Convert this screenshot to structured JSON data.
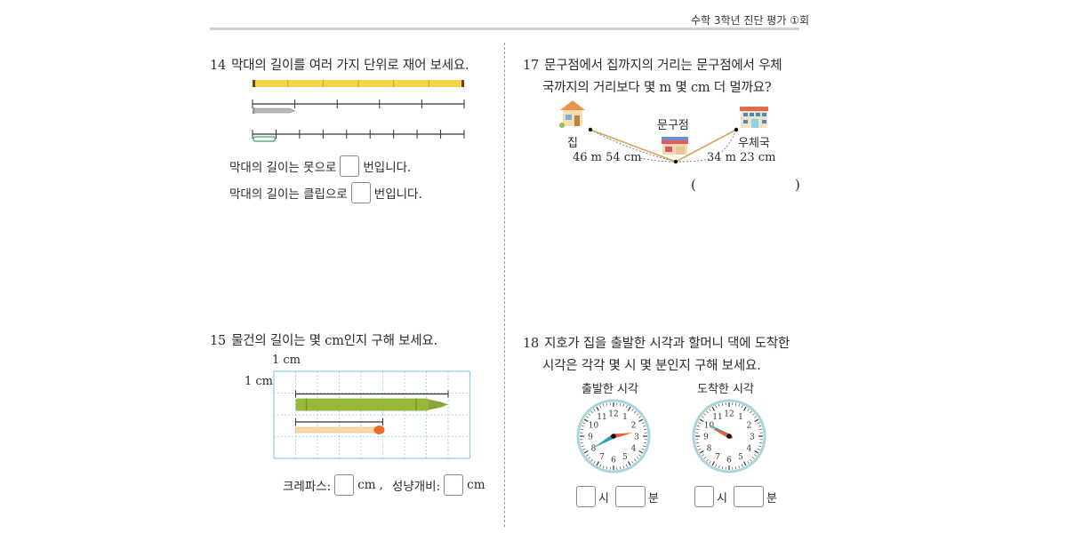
{
  "header": {
    "title": "수학 3학년 진단 평가 ①회"
  },
  "questions": {
    "q14": {
      "number": "14",
      "text": "막대의 길이를 여러 가지 단위로 재어 보세요.",
      "bar_segments": 6,
      "nail_units": 5,
      "clip_units": 9,
      "sentence1_before": "막대의 길이는 못으로",
      "sentence1_after": "번입니다.",
      "sentence2_before": "막대의 길이는 클립으로",
      "sentence2_after": "번입니다.",
      "colors": {
        "bar": "#f2d34a",
        "clip": "#3aa667",
        "nail": "#b8b8b8"
      }
    },
    "q15": {
      "number": "15",
      "text": "물건의 길이는 몇 cm인지 구해 보세요.",
      "grid_unit_x_label": "1 cm",
      "grid_unit_y_label": "1 cm",
      "grid_columns": 9,
      "grid_rows": 4,
      "crayon_length_cm": 7,
      "match_length_cm": 4,
      "answer_label_1": "크레파스:",
      "answer_unit_1": "cm",
      "answer_sep": ",",
      "answer_label_2": "성냥개비:",
      "answer_unit_2": "cm",
      "colors": {
        "crayon": "#98b83c",
        "match_head": "#f06a2a",
        "match_stick": "#f8d9a8",
        "grid": "#8fd0e8"
      }
    },
    "q17": {
      "number": "17",
      "text_line1": "문구점에서 집까지의 거리는 문구점에서 우체",
      "text_line2": "국까지의 거리보다 몇 m 몇 cm 더 멀까요?",
      "label_home": "집",
      "label_store": "문구점",
      "label_post": "우체국",
      "distance_home": "46 m  54 cm",
      "distance_post": "34 m  23 cm",
      "paren_open": "(",
      "paren_close": ")"
    },
    "q18": {
      "number": "18",
      "text_line1": "지호가 집을 출발한 시각과 할머니 댁에 도착한",
      "text_line2": "시각은 각각 몇 시 몇 분인지 구해 보세요.",
      "clock1_caption": "출발한 시각",
      "clock2_caption": "도착한 시각",
      "clock1_time": {
        "hour": 2,
        "minute": 40
      },
      "clock2_time": {
        "hour": 9,
        "minute": 50
      },
      "clock_numbers": [
        "12",
        "1",
        "2",
        "3",
        "4",
        "5",
        "6",
        "7",
        "8",
        "9",
        "10",
        "11"
      ],
      "hour_unit": "시",
      "minute_unit": "분",
      "colors": {
        "hour_hand": "#ee5a3a",
        "minute_hand": "#2f9fb5",
        "rim": "#a8d4dc"
      }
    }
  }
}
